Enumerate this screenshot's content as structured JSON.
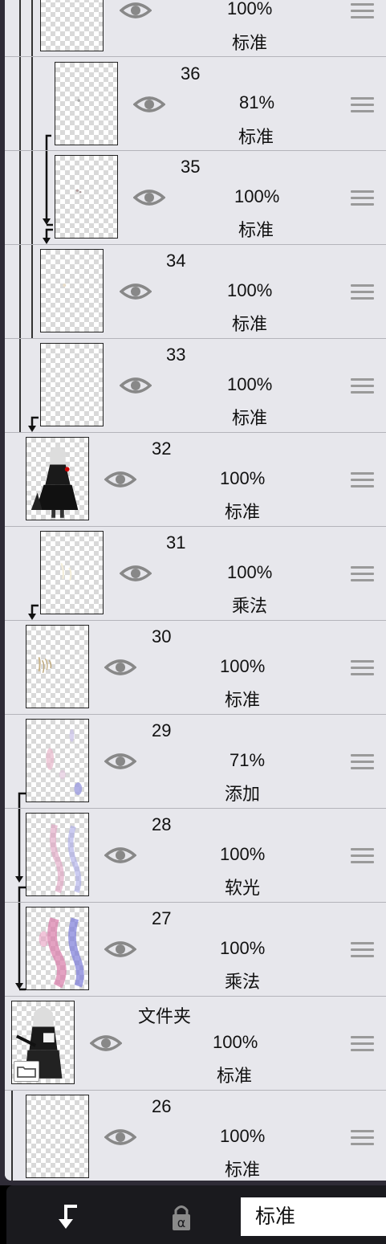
{
  "layers": [
    {
      "name": "",
      "opacity": "100%",
      "blend": "标准",
      "visible": true,
      "art": "blank"
    },
    {
      "name": "36",
      "opacity": "81%",
      "blend": "标准",
      "visible": true,
      "art": "dot"
    },
    {
      "name": "35",
      "opacity": "100%",
      "blend": "标准",
      "visible": true,
      "art": "dot"
    },
    {
      "name": "34",
      "opacity": "100%",
      "blend": "标准",
      "visible": true,
      "art": "faint"
    },
    {
      "name": "33",
      "opacity": "100%",
      "blend": "标准",
      "visible": true,
      "art": "blank"
    },
    {
      "name": "32",
      "opacity": "100%",
      "blend": "标准",
      "visible": true,
      "art": "figure"
    },
    {
      "name": "31",
      "opacity": "100%",
      "blend": "乘法",
      "visible": true,
      "art": "faint"
    },
    {
      "name": "30",
      "opacity": "100%",
      "blend": "标准",
      "visible": true,
      "art": "sketch"
    },
    {
      "name": "29",
      "opacity": "71%",
      "blend": "添加",
      "visible": true,
      "art": "glow-light"
    },
    {
      "name": "28",
      "opacity": "100%",
      "blend": "软光",
      "visible": true,
      "art": "glow-mid"
    },
    {
      "name": "27",
      "opacity": "100%",
      "blend": "乘法",
      "visible": true,
      "art": "glow-strong"
    },
    {
      "name": "文件夹",
      "opacity": "100%",
      "blend": "标准",
      "visible": true,
      "art": "figure",
      "folder": true
    },
    {
      "name": "26",
      "opacity": "100%",
      "blend": "标准",
      "visible": true,
      "art": "blank"
    }
  ],
  "bottom_bar": {
    "clip_icon": "clip-arrow-icon",
    "alpha_lock_icon": "alpha-lock-icon",
    "alpha_symbol": "α",
    "blend_mode": "标准"
  }
}
